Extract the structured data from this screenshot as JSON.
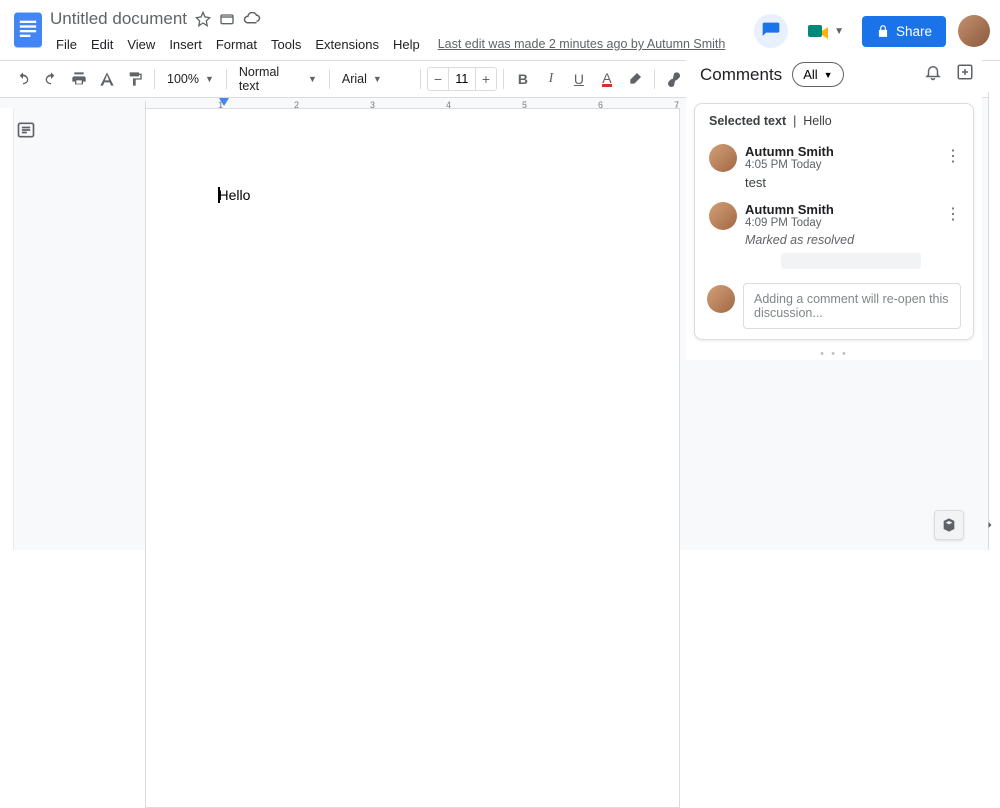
{
  "header": {
    "title": "Untitled document",
    "menus": [
      "File",
      "Edit",
      "View",
      "Insert",
      "Format",
      "Tools",
      "Extensions",
      "Help"
    ],
    "edit_status": "Last edit was made 2 minutes ago by Autumn Smith",
    "share_label": "Share"
  },
  "toolbar": {
    "zoom": "100%",
    "style": "Normal text",
    "font": "Arial",
    "font_size": "11"
  },
  "document": {
    "body_text": "Hello"
  },
  "comments": {
    "title": "Comments",
    "filter": "All",
    "selected_label": "Selected text",
    "selected_value": "Hello",
    "items": [
      {
        "author": "Autumn Smith",
        "time": "4:05 PM Today",
        "text": "test"
      },
      {
        "author": "Autumn Smith",
        "time": "4:09 PM Today",
        "resolved": "Marked as resolved"
      }
    ],
    "reply_placeholder": "Adding a comment will re-open this discussion..."
  }
}
